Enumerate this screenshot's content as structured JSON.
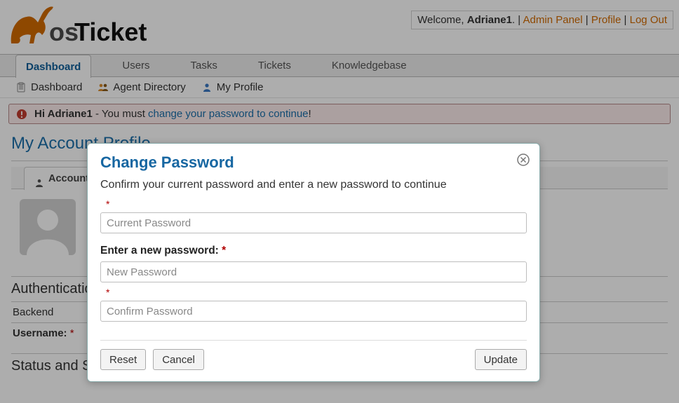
{
  "header": {
    "welcome_prefix": "Welcome, ",
    "username": "Adriane1",
    "welcome_suffix": ".",
    "links": {
      "admin_panel": "Admin Panel",
      "profile": "Profile",
      "logout": "Log Out"
    }
  },
  "top_nav": {
    "items": [
      {
        "label": "Dashboard",
        "active": true
      },
      {
        "label": "Users",
        "active": false
      },
      {
        "label": "Tasks",
        "active": false
      },
      {
        "label": "Tickets",
        "active": false
      },
      {
        "label": "Knowledgebase",
        "active": false
      }
    ]
  },
  "sub_nav": {
    "items": [
      {
        "label": "Dashboard",
        "icon": "clipboard-icon"
      },
      {
        "label": "Agent Directory",
        "icon": "people-icon"
      },
      {
        "label": "My Profile",
        "icon": "person-icon"
      }
    ]
  },
  "alert": {
    "prefix_bold": "Hi Adriane1",
    "middle": " - You must ",
    "link_text": "change your password to continue",
    "suffix": "!"
  },
  "page": {
    "title": "My Account Profile",
    "profile_tabs": [
      {
        "label": "Account",
        "active": true,
        "icon": "user-icon"
      }
    ],
    "sections": {
      "auth_title": "Authentication",
      "backend_label": "Backend",
      "username_label": "Username:",
      "status_title": "Status and Settings"
    }
  },
  "modal": {
    "title": "Change Password",
    "description": "Confirm your current password and enter a new password to continue",
    "current_placeholder": "Current Password",
    "new_label": "Enter a new password:",
    "new_placeholder": "New Password",
    "confirm_placeholder": "Confirm Password",
    "buttons": {
      "reset": "Reset",
      "cancel": "Cancel",
      "update": "Update"
    }
  },
  "colors": {
    "brand_orange": "#d26a00",
    "brand_blue": "#1767a2"
  }
}
